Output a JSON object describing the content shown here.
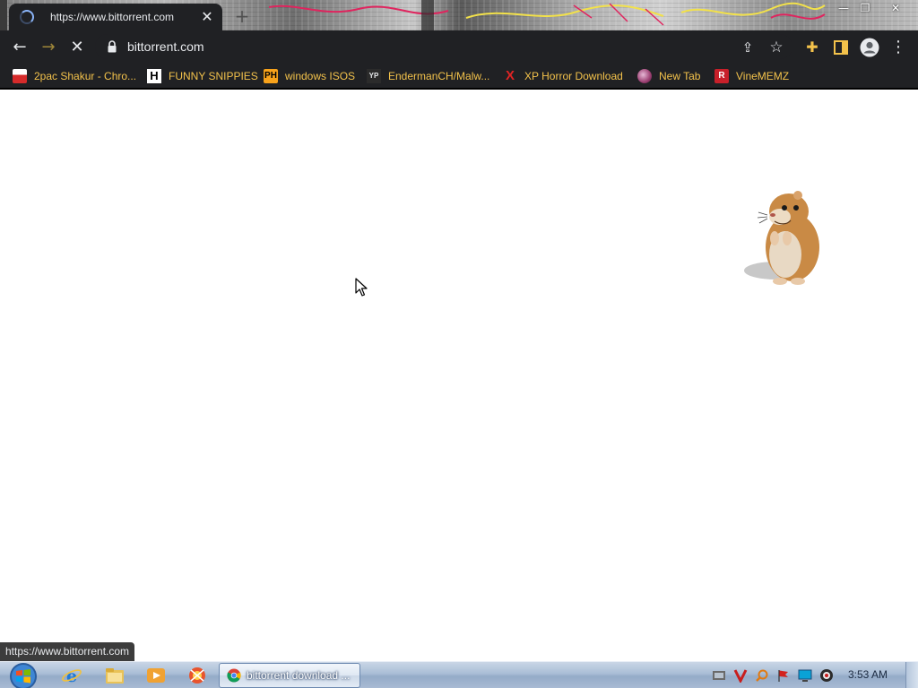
{
  "tab": {
    "title": "https://www.bittorrent.com",
    "close_glyph": "✕",
    "new_tab_glyph": "+"
  },
  "window_controls": {
    "minimize": "—",
    "maximize": "❐",
    "close": "✕"
  },
  "toolbar": {
    "back_glyph": "←",
    "forward_glyph": "→",
    "stop_glyph": "✕",
    "url": "bittorrent.com",
    "share_glyph": "⇪",
    "star_glyph": "☆",
    "extensions_glyph": "✚",
    "menu_glyph": "⋮"
  },
  "bookmarks": [
    {
      "label": "2pac Shakur - Chro...",
      "icon": "youtube-red-icon"
    },
    {
      "label": "FUNNY SNIPPIES",
      "icon": "letter-h-icon",
      "fav_text": "H"
    },
    {
      "label": "windows ISOS",
      "icon": "ph-icon",
      "fav_text": "PH"
    },
    {
      "label": "EndermanCH/Malw...",
      "icon": "yp-icon",
      "fav_text": "YP"
    },
    {
      "label": "XP Horror Download",
      "icon": "red-x-icon",
      "fav_text": "X"
    },
    {
      "label": "New Tab",
      "icon": "globe-icon"
    },
    {
      "label": "VineMEMZ",
      "icon": "letter-r-icon",
      "fav_text": "R"
    }
  ],
  "status_url": "https://www.bittorrent.com",
  "taskbar": {
    "active_window_label": "bittorrent download ...",
    "clock": "3:53 AM"
  },
  "colors": {
    "toolbar_bg": "#202124",
    "bookmark_text": "#f3c24b",
    "page_bg": "#ffffff"
  }
}
